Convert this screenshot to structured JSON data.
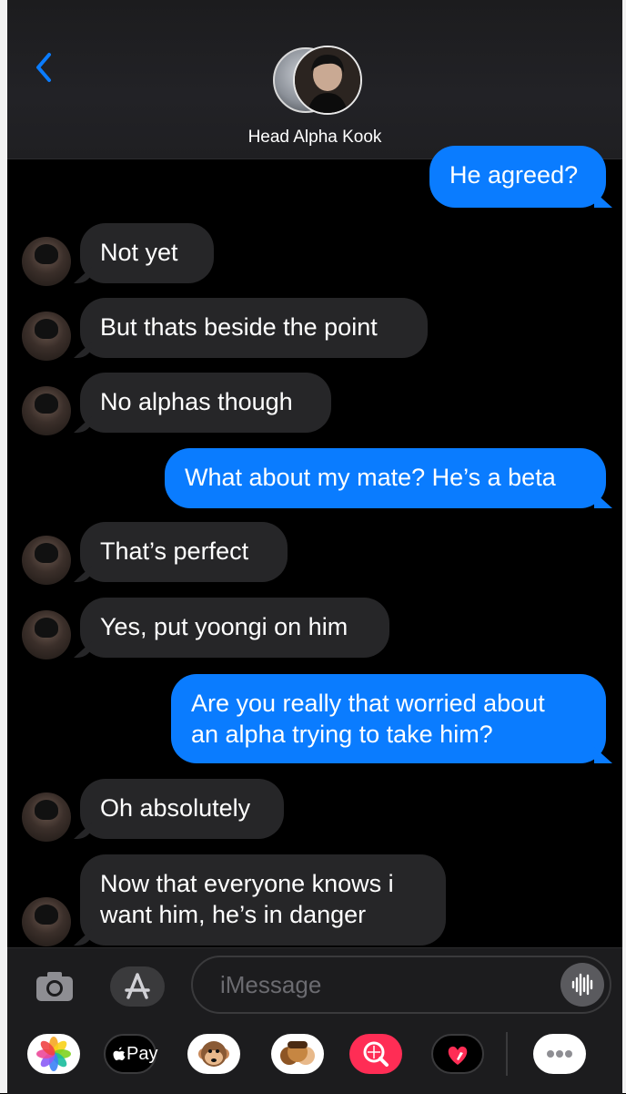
{
  "header": {
    "contact_name": "Head Alpha Kook"
  },
  "messages": [
    {
      "side": "out",
      "lines": [
        "He agreed?"
      ]
    },
    {
      "side": "in",
      "lines": [
        "Not yet"
      ]
    },
    {
      "side": "in",
      "lines": [
        "But thats beside the point"
      ]
    },
    {
      "side": "in",
      "lines": [
        "No alphas though"
      ]
    },
    {
      "side": "out",
      "lines": [
        "What about my mate? He’s a beta"
      ]
    },
    {
      "side": "in",
      "lines": [
        "That’s perfect"
      ]
    },
    {
      "side": "in",
      "lines": [
        "Yes, put yoongi on him"
      ]
    },
    {
      "side": "out",
      "lines": [
        "Are you really that worried about",
        "an alpha trying to take him?"
      ]
    },
    {
      "side": "in",
      "lines": [
        "Oh absolutely"
      ]
    },
    {
      "side": "in",
      "lines": [
        "Now that everyone knows i",
        "want him, he’s in danger"
      ]
    }
  ],
  "compose": {
    "placeholder": "iMessage"
  },
  "app_drawer": {
    "apple_pay_label": "Pay",
    "apps": [
      "photos-app-icon",
      "apple-pay-icon",
      "monkey-animoji-icon",
      "memoji-icon",
      "image-search-icon",
      "digital-touch-icon",
      "more-apps-icon"
    ]
  },
  "colors": {
    "outgoing_bubble": "#0a7cff",
    "incoming_bubble": "#262628",
    "accent": "#0a7cff",
    "background": "#000000"
  }
}
